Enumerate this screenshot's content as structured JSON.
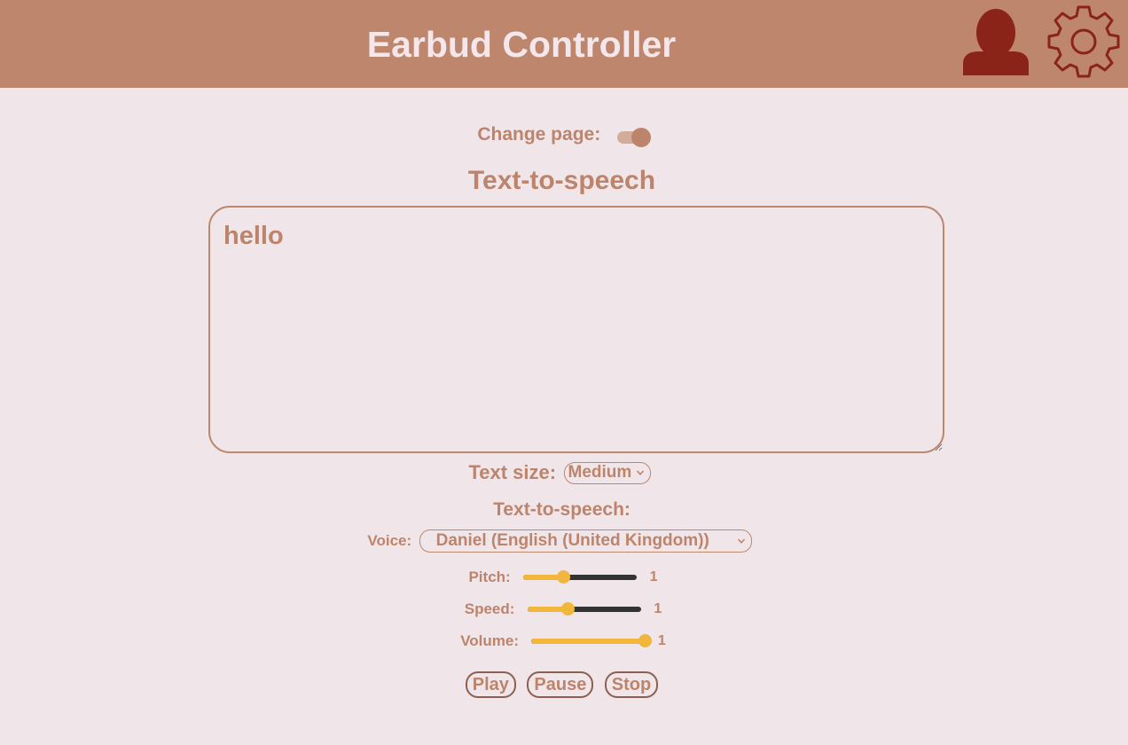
{
  "header": {
    "title": "Earbud Controller",
    "bg_color": "#bd866d",
    "icons": [
      "user-icon",
      "gear-icon"
    ]
  },
  "page_toggle": {
    "label": "Change page:",
    "on": true
  },
  "tts": {
    "title": "Text-to-speech",
    "text": "hello",
    "text_size_label": "Text size:",
    "text_size_value": "Medium",
    "settings_title": "Text-to-speech:",
    "voice_label": "Voice:",
    "voice_value": "Daniel (English (United Kingdom))",
    "pitch": {
      "label": "Pitch:",
      "value": "1",
      "fraction": 0.35
    },
    "speed": {
      "label": "Speed:",
      "value": "1",
      "fraction": 0.35
    },
    "volume": {
      "label": "Volume:",
      "value": "1",
      "fraction": 1.0
    },
    "buttons": {
      "play": "Play",
      "pause": "Pause",
      "stop": "Stop"
    }
  },
  "colors": {
    "accent": "#bd846c",
    "background": "#f0e6ea",
    "slider_fill": "#f2b63d",
    "icon_red": "#8a2318"
  }
}
